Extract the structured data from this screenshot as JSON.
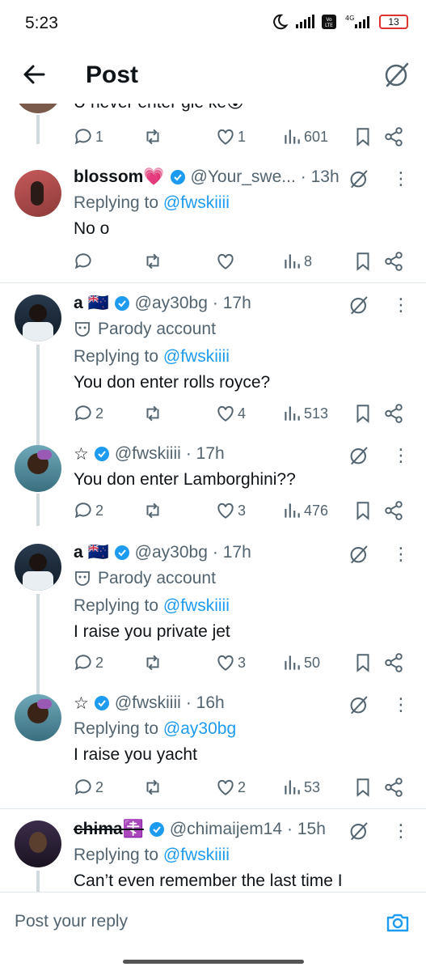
{
  "status": {
    "time": "5:23",
    "battery": "13"
  },
  "header": {
    "title": "Post"
  },
  "partial": {
    "text": "U never enter gle ke😮",
    "replies": "1",
    "likes": "1",
    "views": "601"
  },
  "tweets": [
    {
      "name": "blossom💗",
      "handle": "@Your_swe...",
      "time": "· 13h",
      "replying_to_label": "Replying to",
      "replying_to": "@fwskiiii",
      "text": "No o",
      "replies": "",
      "likes": "",
      "views": "8"
    },
    {
      "name": "a 🇳🇿",
      "handle": "@ay30bg",
      "time": "· 17h",
      "parody_label": "Parody account",
      "replying_to_label": "Replying to",
      "replying_to": "@fwskiiii",
      "text": "You don enter rolls royce?",
      "replies": "2",
      "likes": "4",
      "views": "513"
    },
    {
      "name": "☆",
      "handle": "@fwskiiii",
      "time": "· 17h",
      "text": "You don enter Lamborghini??",
      "replies": "2",
      "likes": "3",
      "views": "476"
    },
    {
      "name": "a 🇳🇿",
      "handle": "@ay30bg",
      "time": "· 17h",
      "parody_label": "Parody account",
      "replying_to_label": "Replying to",
      "replying_to": "@fwskiiii",
      "text": "I raise you private jet",
      "replies": "2",
      "likes": "3",
      "views": "50"
    },
    {
      "name": "☆",
      "handle": "@fwskiiii",
      "time": "· 16h",
      "replying_to_label": "Replying to",
      "replying_to": "@ay30bg",
      "text": "I raise you yacht",
      "replies": "2",
      "likes": "2",
      "views": "53"
    },
    {
      "name": "chima☦️",
      "handle": "@chimaijem14",
      "time": "· 15h",
      "replying_to_label": "Replying to",
      "replying_to": "@fwskiiii",
      "text": "Can’t even remember the last time I"
    }
  ],
  "reply": {
    "placeholder": "Post your reply"
  },
  "colors": {
    "accent": "#1d9bf0",
    "muted": "#536471",
    "divider": "#e1e8ed"
  }
}
